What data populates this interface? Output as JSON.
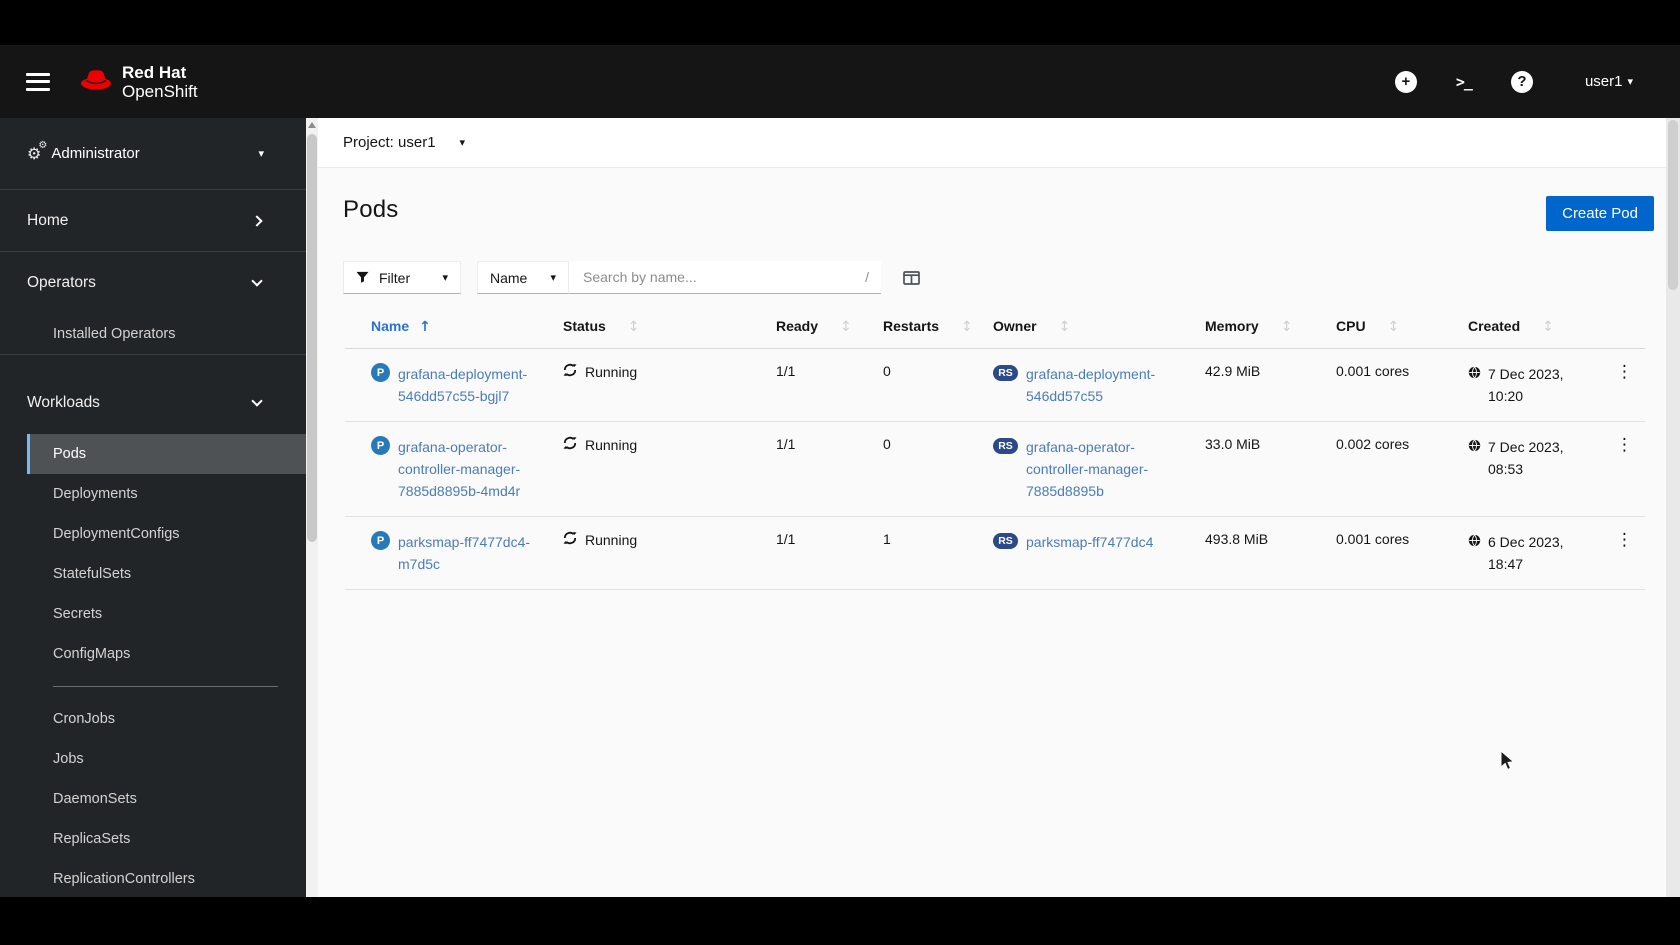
{
  "masthead": {
    "brand": {
      "line1": "Red Hat",
      "line2": "OpenShift"
    },
    "user": "user1"
  },
  "sidebar": {
    "perspective": "Administrator",
    "home": "Home",
    "operators": {
      "label": "Operators",
      "items": [
        {
          "label": "Installed Operators"
        }
      ]
    },
    "workloads": {
      "label": "Workloads",
      "active_item": "Pods",
      "items": [
        {
          "label": "Pods"
        },
        {
          "label": "Deployments"
        },
        {
          "label": "DeploymentConfigs"
        },
        {
          "label": "StatefulSets"
        },
        {
          "label": "Secrets"
        },
        {
          "label": "ConfigMaps"
        }
      ],
      "items2": [
        {
          "label": "CronJobs"
        },
        {
          "label": "Jobs"
        },
        {
          "label": "DaemonSets"
        },
        {
          "label": "ReplicaSets"
        },
        {
          "label": "ReplicationControllers"
        }
      ]
    }
  },
  "content": {
    "project_bar": {
      "label": "Project: user1"
    },
    "page_title": "Pods",
    "create_button": "Create Pod",
    "toolbar": {
      "filter_label": "Filter",
      "name_label": "Name",
      "search_placeholder": "Search by name...",
      "search_shortcut": "/"
    },
    "table": {
      "columns": [
        "Name",
        "Status",
        "Ready",
        "Restarts",
        "Owner",
        "Memory",
        "CPU",
        "Created"
      ],
      "sort": {
        "column": "Name",
        "direction": "ascending"
      },
      "rows": [
        {
          "badge": "P",
          "name": "grafana-deployment-546dd57c55-bgjl7",
          "status": "Running",
          "ready": "1/1",
          "restarts": "0",
          "owner_badge": "RS",
          "owner": "grafana-deployment-546dd57c55",
          "memory": "42.9 MiB",
          "cpu": "0.001 cores",
          "created": "7 Dec 2023, 10:20"
        },
        {
          "badge": "P",
          "name": "grafana-operator-controller-manager-7885d8895b-4md4r",
          "status": "Running",
          "ready": "1/1",
          "restarts": "0",
          "owner_badge": "RS",
          "owner": "grafana-operator-controller-manager-7885d8895b",
          "memory": "33.0 MiB",
          "cpu": "0.002 cores",
          "created": "7 Dec 2023, 08:53"
        },
        {
          "badge": "P",
          "name": "parksmap-ff7477dc4-m7d5c",
          "status": "Running",
          "ready": "1/1",
          "restarts": "1",
          "owner_badge": "RS",
          "owner": "parksmap-ff7477dc4",
          "memory": "493.8 MiB",
          "cpu": "0.001 cores",
          "created": "6 Dec 2023, 18:47"
        }
      ]
    }
  },
  "colors": {
    "accent": "#0066cc",
    "masthead_bg": "#151515",
    "sidebar_bg": "#222527",
    "active_nav_border": "#73bcf7",
    "link": "#4a7cba",
    "brand_red": "#ee0000",
    "pod_badge": "#2779b8",
    "replicaset_badge": "#2b4a87"
  }
}
